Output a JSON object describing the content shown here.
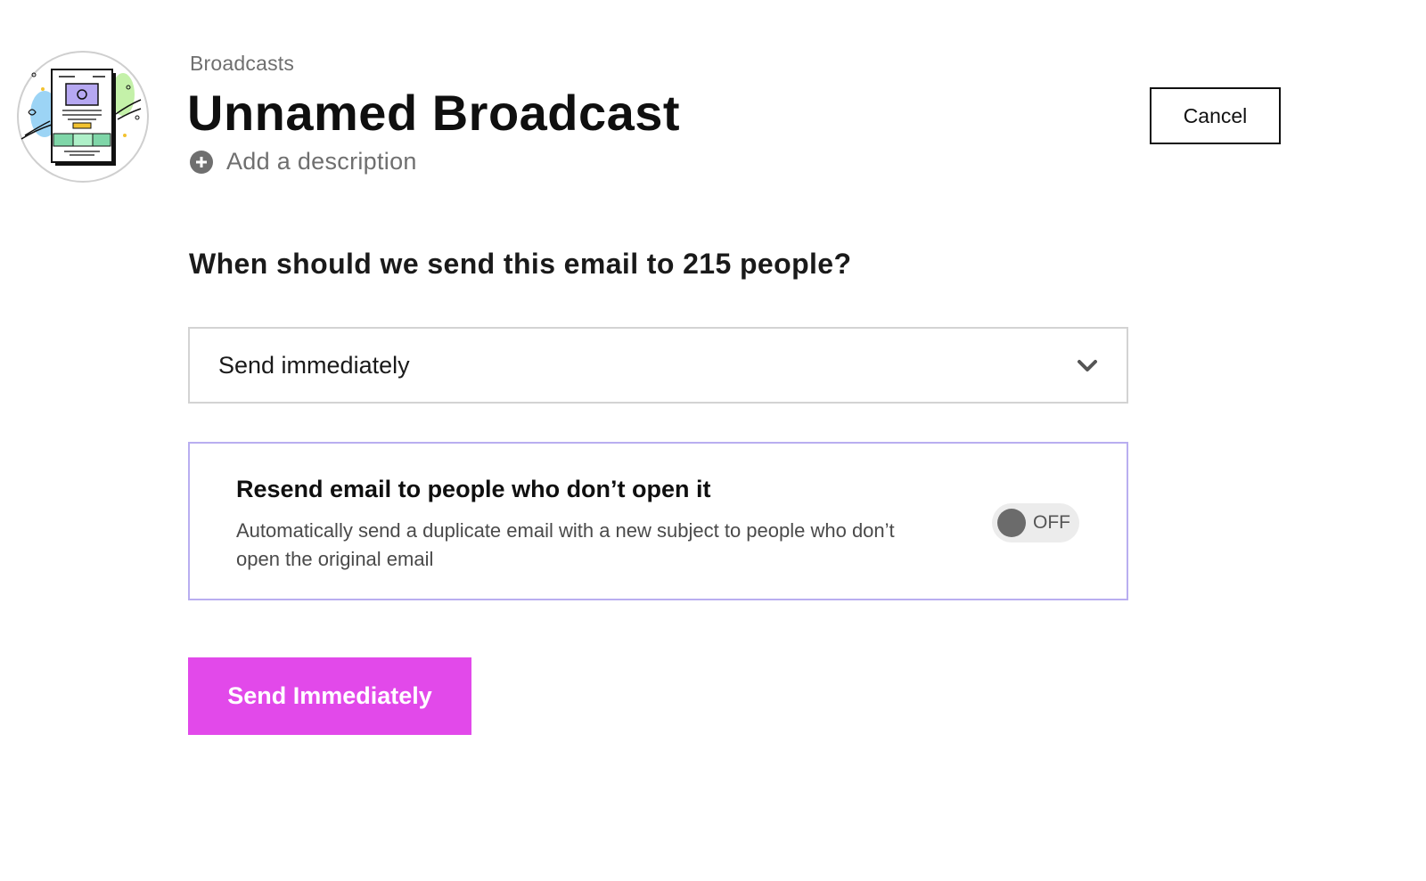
{
  "header": {
    "breadcrumb": "Broadcasts",
    "title": "Unnamed Broadcast",
    "add_description_label": "Add a description",
    "cancel_label": "Cancel"
  },
  "schedule": {
    "question": "When should we send this email to 215 people?",
    "selected_option": "Send immediately"
  },
  "resend": {
    "title": "Resend email to people who don’t open it",
    "description": "Automatically send a duplicate email with a new subject to people who don’t open the original email",
    "toggle_state": "OFF",
    "enabled": false
  },
  "actions": {
    "send_label": "Send Immediately"
  },
  "icons": {
    "avatar": "broadcast-email-illustration",
    "add_description": "plus-circle-icon",
    "select": "chevron-down-icon"
  },
  "colors": {
    "accent": "#e249ea",
    "card_border": "#b9aef0",
    "select_border": "#d3d3d3"
  }
}
